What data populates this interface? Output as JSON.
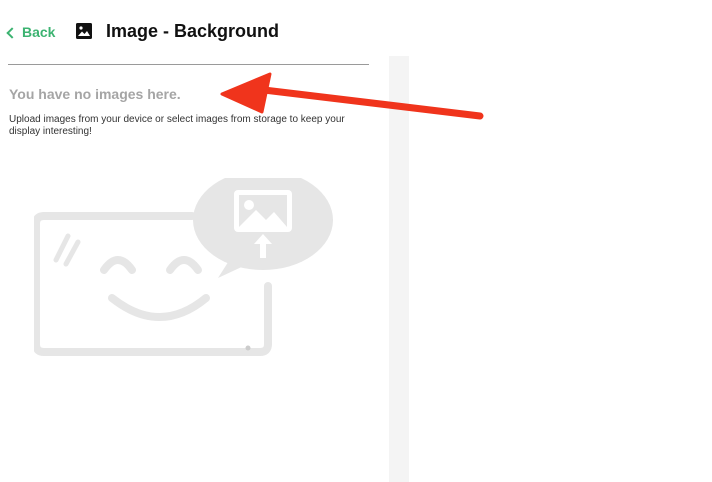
{
  "header": {
    "back_label": "Back",
    "title": "Image - Background",
    "title_icon": "image-icon"
  },
  "empty_state": {
    "title": "You have no images here.",
    "description": "Upload images from your device or select images from storage to keep your display interesting!",
    "illustration": "smiling-screen-with-image-upload-bubble"
  },
  "colors": {
    "accent": "#3cb371",
    "annotation_arrow": "#f0341c",
    "illustration": "#e6e6e6"
  }
}
